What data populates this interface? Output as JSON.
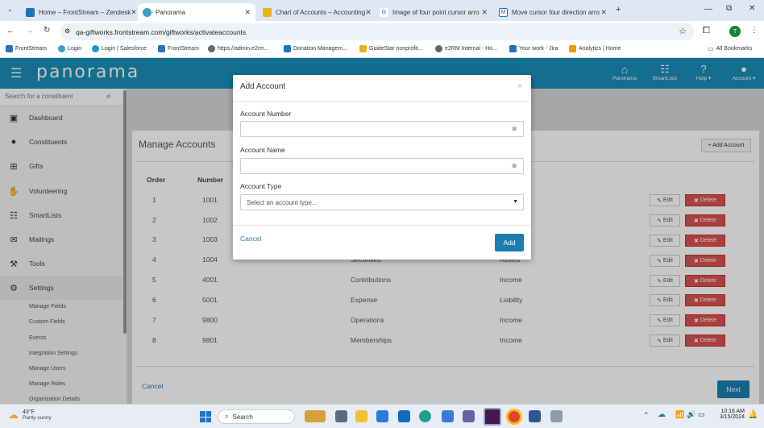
{
  "browser": {
    "tabs": [
      {
        "title": "Home – FrontStream – Zendesk",
        "active": false,
        "color": "#1f73b7"
      },
      {
        "title": "Panorama",
        "active": true,
        "color": "#3aa0c8"
      },
      {
        "title": "Chart of Accounts – Accounting",
        "active": false,
        "color": "#e7b416"
      },
      {
        "title": "Image of four point cursor arro",
        "active": false,
        "color": "#4285f4"
      },
      {
        "title": "Move cursor four direction arro",
        "active": false,
        "color": "#1f73b7"
      }
    ],
    "url": "qa-giftworks.frontstream.com/giftworks/activateaccounts",
    "bookmarks": [
      "FrontStream",
      "Login",
      "Login | Salesforce",
      "FrontStream",
      "https://admin.e2rm...",
      "Donation Managem...",
      "GuideStar nonprofit...",
      "e2RM Internal - Ho...",
      "Your work - Jira",
      "Analytics | Home"
    ],
    "all_bookmarks": "All Bookmarks",
    "profile_initial": "T"
  },
  "app": {
    "logo": "panorama",
    "nav": [
      {
        "label": "Panorama",
        "icon": "home-icon"
      },
      {
        "label": "SmartLists",
        "icon": "list-icon"
      },
      {
        "label": "Help ▾",
        "icon": "help-icon"
      },
      {
        "label": "Account ▾",
        "icon": "user-icon"
      }
    ],
    "search_placeholder": "Search for a constituent"
  },
  "sidebar": {
    "items": [
      {
        "label": "Dashboard",
        "icon": "dashboard-icon"
      },
      {
        "label": "Constituents",
        "icon": "person-icon"
      },
      {
        "label": "Gifts",
        "icon": "gift-icon"
      },
      {
        "label": "Volunteering",
        "icon": "volunteer-icon"
      },
      {
        "label": "SmartLists",
        "icon": "list-icon"
      },
      {
        "label": "Mailings",
        "icon": "mail-icon"
      },
      {
        "label": "Tools",
        "icon": "wrench-icon"
      },
      {
        "label": "Settings",
        "icon": "gear-icon"
      }
    ],
    "subitems": [
      "Manage Fields",
      "Custom Fields",
      "Events",
      "Integration Settings",
      "Manage Users",
      "Manage Roles",
      "Organization Details"
    ]
  },
  "manage": {
    "title": "Manage Accounts",
    "add_button": "+ Add Account",
    "columns": [
      "Order",
      "Number"
    ],
    "rows": [
      {
        "order": "1",
        "number": "1001",
        "name": "",
        "type": ""
      },
      {
        "order": "2",
        "number": "1002",
        "name": "",
        "type": ""
      },
      {
        "order": "3",
        "number": "1003",
        "name": "",
        "type": ""
      },
      {
        "order": "4",
        "number": "1004",
        "name": "Securities",
        "type": "Assets"
      },
      {
        "order": "5",
        "number": "4001",
        "name": "Contributions",
        "type": "Income"
      },
      {
        "order": "6",
        "number": "5001",
        "name": "Expense",
        "type": "Liability"
      },
      {
        "order": "7",
        "number": "9800",
        "name": "Operations",
        "type": "Income"
      },
      {
        "order": "8",
        "number": "9801",
        "name": "Memberships",
        "type": "Income"
      }
    ],
    "edit_label": "Edit",
    "delete_label": "Delete",
    "cancel": "Cancel",
    "next": "Next"
  },
  "modal": {
    "title": "Add Account",
    "close": "×",
    "account_number_label": "Account Number",
    "account_name_label": "Account Name",
    "account_type_label": "Account Type",
    "account_type_placeholder": "Select an account type...",
    "cancel": "Cancel",
    "add": "Add"
  },
  "taskbar": {
    "temperature": "43°F",
    "weather": "Partly sunny",
    "search_placeholder": "Search",
    "time": "10:18 AM",
    "date": "3/15/2024"
  }
}
